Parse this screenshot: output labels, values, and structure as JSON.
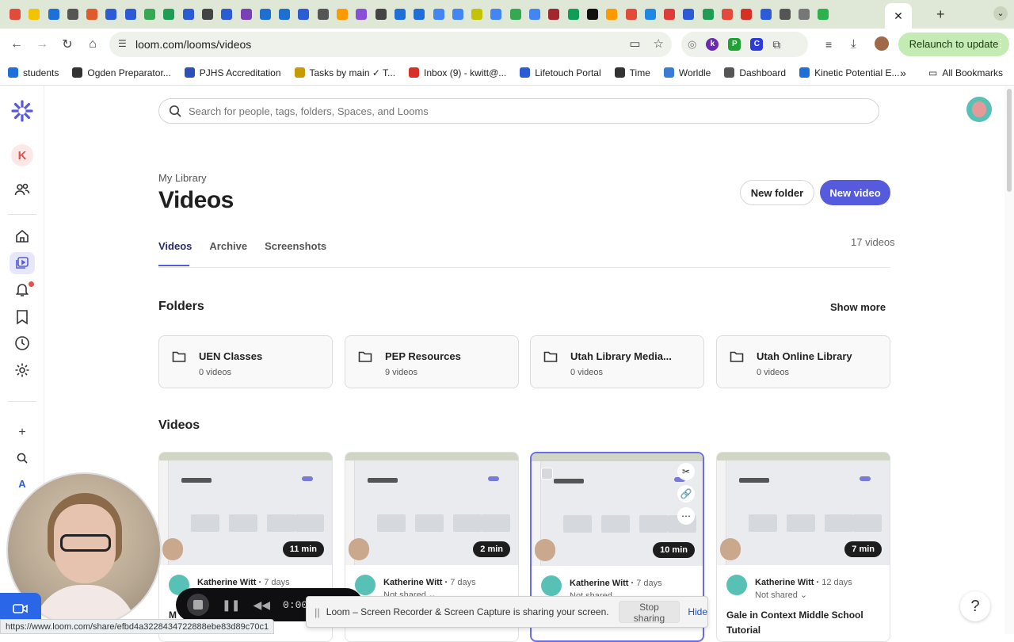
{
  "browser": {
    "url": "loom.com/looms/videos",
    "relaunch_label": "Relaunch to update",
    "tab_favicons": [
      "#e34a3a",
      "#f2c300",
      "#1e6fd9",
      "#555",
      "#e05a2a",
      "#2c5bd6",
      "#2c5bd6",
      "#34a853",
      "#1f9d55",
      "#2c5bd6",
      "#444",
      "#2c5bd6",
      "#7a3fb8",
      "#1d6fd1",
      "#1d6fd1",
      "#2c5bd6",
      "#555",
      "#ff9900",
      "#8a4fd9",
      "#444",
      "#1e6fd9",
      "#1e6fd9",
      "#4285f4",
      "#4285f4",
      "#c3c300",
      "#4285f4",
      "#34a853",
      "#4285f4",
      "#a3262d",
      "#0f9d58",
      "#111",
      "#ff9900",
      "#e34a3a",
      "#1e88e5",
      "#e03a3a",
      "#2c5bd6",
      "#1f9d55",
      "#e34a3a",
      "#d93025",
      "#2c5bd6",
      "#555",
      "#777",
      "#2bb24c"
    ],
    "bookmarks": [
      {
        "label": "students",
        "color": "#1e6fd9"
      },
      {
        "label": "Ogden Preparator...",
        "color": "#333"
      },
      {
        "label": "PJHS Accreditation",
        "color": "#2c4fb8"
      },
      {
        "label": "Tasks by main ✓ T...",
        "color": "#c79a00"
      },
      {
        "label": "Inbox (9) - kwitt@...",
        "color": "#d93025"
      },
      {
        "label": "Lifetouch Portal",
        "color": "#2c5bd6"
      },
      {
        "label": "Time",
        "color": "#333"
      },
      {
        "label": "Worldle",
        "color": "#3a7bd5"
      },
      {
        "label": "Dashboard",
        "color": "#555"
      },
      {
        "label": "Kinetic Potential E...",
        "color": "#1e6fd9"
      }
    ],
    "all_bookmarks_label": "All Bookmarks"
  },
  "sidebar": {
    "workspace_letter": "K"
  },
  "search": {
    "placeholder": "Search for people, tags, folders, Spaces, and Looms"
  },
  "header": {
    "breadcrumb": "My Library",
    "title": "Videos",
    "new_folder_label": "New folder",
    "new_video_label": "New video"
  },
  "tabs": [
    {
      "label": "Videos",
      "active": true
    },
    {
      "label": "Archive",
      "active": false
    },
    {
      "label": "Screenshots",
      "active": false
    }
  ],
  "video_count": "17 videos",
  "folders_section": {
    "heading": "Folders",
    "show_more": "Show more",
    "items": [
      {
        "name": "UEN Classes",
        "count": "0 videos"
      },
      {
        "name": "PEP Resources",
        "count": "9 videos"
      },
      {
        "name": "Utah Library Media...",
        "count": "0 videos"
      },
      {
        "name": "Utah Online Library",
        "count": "0 videos"
      }
    ]
  },
  "videos_section": {
    "heading": "Videos",
    "items": [
      {
        "duration": "11 min",
        "author": "Katherine Witt",
        "age": "7 days",
        "shared": "",
        "title": "M"
      },
      {
        "duration": "2 min",
        "author": "Katherine Witt",
        "age": "7 days",
        "shared": "Not shared ⌄",
        "title": ""
      },
      {
        "duration": "10 min",
        "author": "Katherine Witt",
        "age": "7 days",
        "shared": "Not shared ⌄",
        "title": ""
      },
      {
        "duration": "7 min",
        "author": "Katherine Witt",
        "age": "12 days",
        "shared": "Not shared ⌄",
        "title": "Gale in Context Middle School Tutorial"
      }
    ]
  },
  "recorder": {
    "time": "0:00"
  },
  "share_bar": {
    "grip": "||",
    "message": "Loom – Screen Recorder & Screen Capture is sharing your screen.",
    "stop_label": "Stop sharing",
    "hide_label": "Hide"
  },
  "status_url": "https://www.loom.com/share/efbd4a3228434722888ebe83d89c70c1",
  "help_label": "?"
}
